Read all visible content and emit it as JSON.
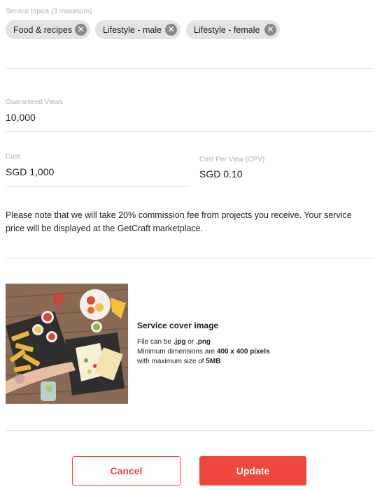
{
  "topics": {
    "label": "Service topics (3 maximum)",
    "chips": [
      {
        "label": "Food & recipes"
      },
      {
        "label": "Lifestyle - male"
      },
      {
        "label": "Lifestyle - female"
      }
    ]
  },
  "views": {
    "label": "Guaranteed Views",
    "value": "10,000"
  },
  "cost": {
    "label": "Cost",
    "value": "SGD 1,000"
  },
  "cpv": {
    "label": "Cost Per View (CPV)",
    "value": "SGD 0.10"
  },
  "note": "Please note that we will take 20% commission fee from projects you receive. Your service price will be displayed at the GetCraft marketplace.",
  "cover": {
    "title": "Service cover image",
    "line1_a": "File can be ",
    "line1_b": ".jpg",
    "line1_c": " or ",
    "line1_d": ".png",
    "line2_a": "Minimum dimensions are ",
    "line2_b": "400 x 400 pixels",
    "line3_a": "with maximum size of ",
    "line3_b": "5MB"
  },
  "actions": {
    "cancel": "Cancel",
    "update": "Update"
  },
  "colors": {
    "accent": "#f0473d",
    "chip_bg": "#e3e3e3",
    "divider": "#dcdcdc"
  }
}
